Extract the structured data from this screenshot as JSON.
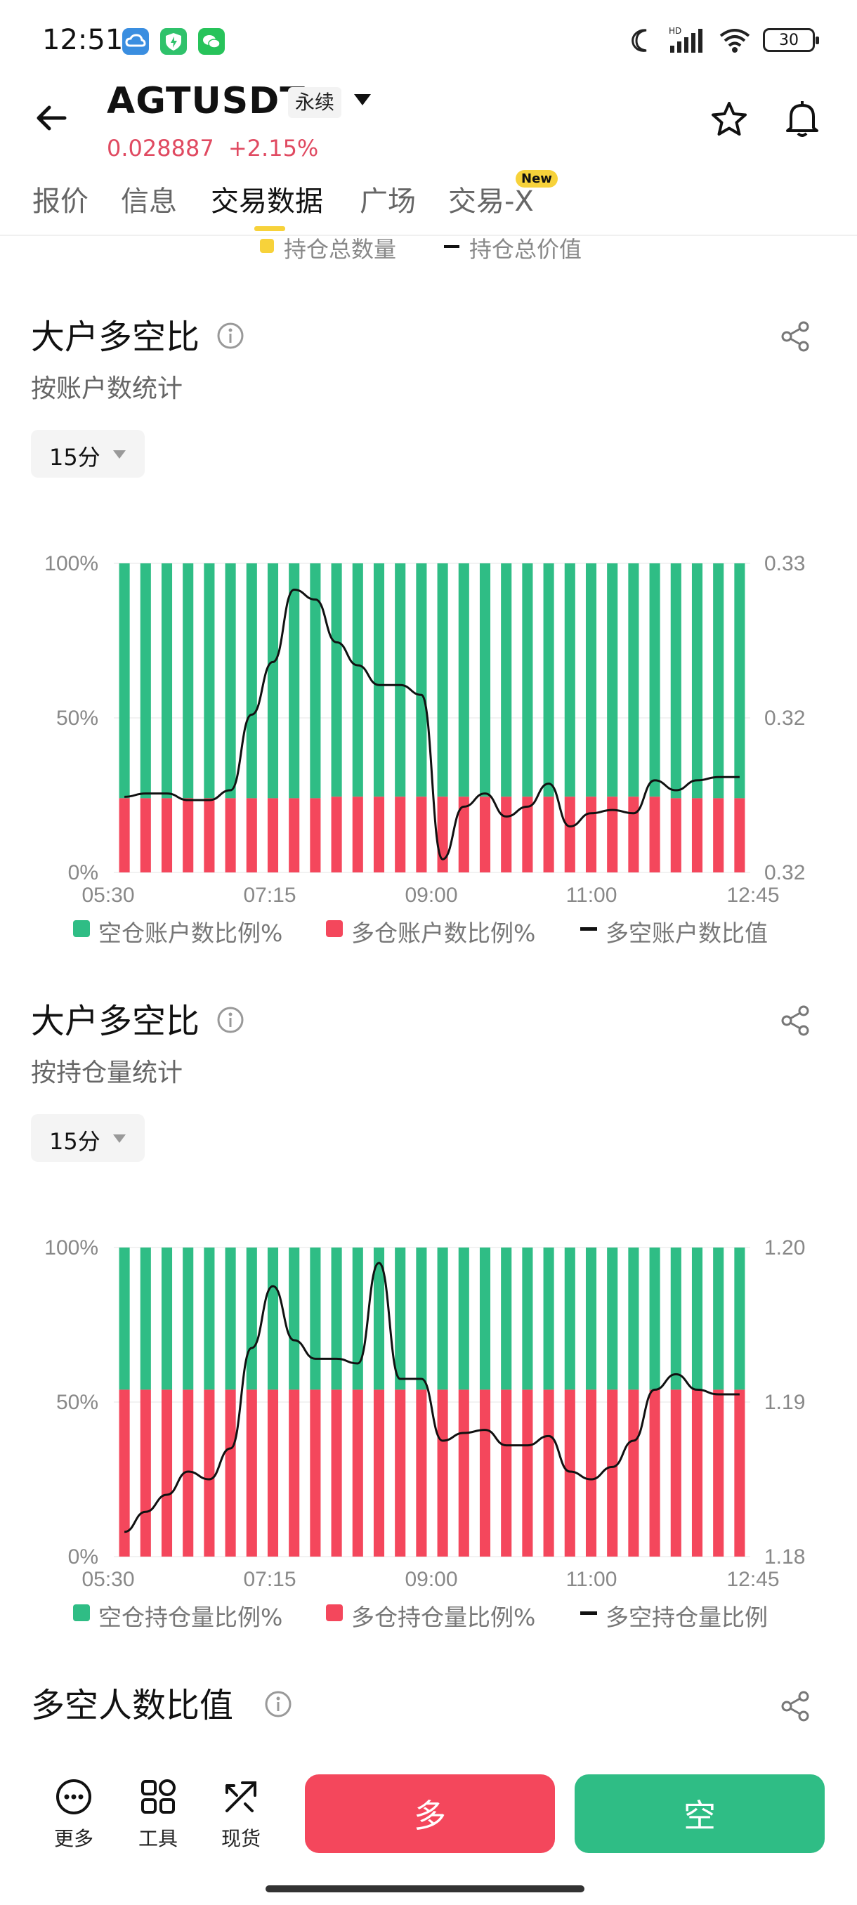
{
  "status_bar": {
    "time": "12:51",
    "battery": "30",
    "network": "HD"
  },
  "header": {
    "symbol": "AGTUSDT",
    "contract_type": "永续",
    "price": "0.028887",
    "change": "+2.15%"
  },
  "tabs": [
    {
      "label": "报价",
      "active": false
    },
    {
      "label": "信息",
      "active": false
    },
    {
      "label": "交易数据",
      "active": true
    },
    {
      "label": "广场",
      "active": false
    },
    {
      "label": "交易-X",
      "active": false,
      "badge": "New"
    }
  ],
  "top_legend": {
    "item1": "持仓总数量",
    "item2": "持仓总价值"
  },
  "sections": [
    {
      "title": "大户多空比",
      "subtitle": "按账户数统计",
      "period": "15分",
      "legend": [
        "空仓账户数比例%",
        "多仓账户数比例%",
        "多空账户数比值"
      ]
    },
    {
      "title": "大户多空比",
      "subtitle": "按持仓量统计",
      "period": "15分",
      "legend": [
        "空仓持仓量比例%",
        "多仓持仓量比例%",
        "多空持仓量比例"
      ]
    },
    {
      "title": "多空人数比值"
    }
  ],
  "chart_data": [
    {
      "type": "bar",
      "x_labels": [
        "05:30",
        "07:15",
        "09:00",
        "11:00",
        "12:45"
      ],
      "left_ticks": [
        "100%",
        "50%",
        "0%"
      ],
      "right_ticks": [
        "0.33",
        "0.32",
        "0.32"
      ],
      "series": [
        {
          "name": "空仓账户数比例%",
          "color": "#2fbd85",
          "values": [
            76,
            76,
            76,
            76,
            76,
            76,
            76,
            76,
            76,
            76,
            75.5,
            75.5,
            75.5,
            75.5,
            75.5,
            75.5,
            75.5,
            75.5,
            75.5,
            75.5,
            75.5,
            75.5,
            75.5,
            75.5,
            75.5,
            75.5,
            76,
            76,
            76,
            76
          ]
        },
        {
          "name": "多仓账户数比例%",
          "color": "#f4475c",
          "values": [
            24,
            24,
            24,
            24,
            24,
            24,
            24,
            24,
            24,
            24,
            24.5,
            24.5,
            24.5,
            24.5,
            24.5,
            24.5,
            24.5,
            24.5,
            24.5,
            24.5,
            24.5,
            24.5,
            24.5,
            24.5,
            24.5,
            24.5,
            24,
            24,
            24,
            24
          ]
        },
        {
          "name": "多空账户数比值",
          "color": "#111111",
          "values": [
            0.3191,
            0.3192,
            0.3192,
            0.319,
            0.319,
            0.3193,
            0.3216,
            0.3232,
            0.3254,
            0.3251,
            0.3238,
            0.3231,
            0.3225,
            0.3225,
            0.3222,
            0.3172,
            0.3188,
            0.3192,
            0.3185,
            0.3188,
            0.3195,
            0.3182,
            0.3186,
            0.3187,
            0.3186,
            0.3196,
            0.3193,
            0.3196,
            0.3197,
            0.3197
          ]
        }
      ]
    },
    {
      "type": "bar",
      "x_labels": [
        "05:30",
        "07:15",
        "09:00",
        "11:00",
        "12:45"
      ],
      "left_ticks": [
        "100%",
        "50%",
        "0%"
      ],
      "right_ticks": [
        "1.20",
        "1.19",
        "1.18"
      ],
      "series": [
        {
          "name": "空仓持仓量比例%",
          "color": "#2fbd85",
          "values": [
            46,
            46,
            46,
            46,
            46,
            46,
            46,
            46,
            46,
            46,
            46,
            46,
            46,
            46,
            46,
            46,
            46,
            46,
            46,
            46,
            46,
            46,
            46,
            46,
            46,
            46,
            46,
            46,
            46,
            46
          ]
        },
        {
          "name": "多仓持仓量比例%",
          "color": "#f4475c",
          "values": [
            54,
            54,
            54,
            54,
            54,
            54,
            54,
            54,
            54,
            54,
            54,
            54,
            54,
            54,
            54,
            54,
            54,
            54,
            54,
            54,
            54,
            54,
            54,
            54,
            54,
            54,
            54,
            54,
            54,
            54
          ]
        },
        {
          "name": "多空持仓量比例",
          "color": "#111111",
          "values": [
            1.1816,
            1.1829,
            1.184,
            1.1855,
            1.185,
            1.187,
            1.1935,
            1.1975,
            1.194,
            1.1928,
            1.1928,
            1.1925,
            1.199,
            1.1915,
            1.1915,
            1.1875,
            1.188,
            1.1882,
            1.1872,
            1.1872,
            1.1878,
            1.1855,
            1.185,
            1.1858,
            1.1875,
            1.1908,
            1.1918,
            1.1908,
            1.1905,
            1.1905
          ]
        }
      ]
    }
  ],
  "bottom_bar": {
    "more": "更多",
    "tools": "工具",
    "spot": "现货",
    "buy": "多",
    "sell": "空"
  },
  "colors": {
    "up": "#2fbd85",
    "down": "#f4475c",
    "price": "#e04a61",
    "accent": "#f7d23a"
  }
}
